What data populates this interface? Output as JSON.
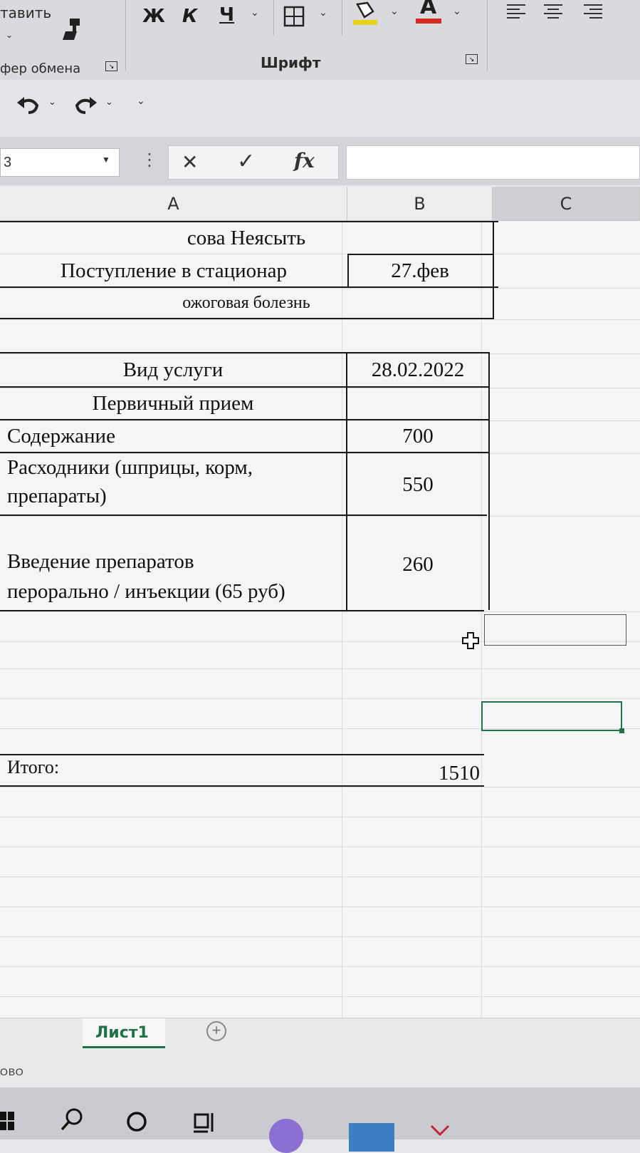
{
  "ribbon": {
    "paste_label": "тавить",
    "clipboard_group": "фер обмена",
    "font_group": "Шрифт",
    "bold": "Ж",
    "italic": "К",
    "underline": "Ч",
    "font_color_letter": "A",
    "icons": [
      "format-painter-icon",
      "borders-icon",
      "fill-color-icon",
      "font-color-icon",
      "align-left-icon",
      "align-center-icon",
      "align-right-icon"
    ]
  },
  "qat": {
    "icons": [
      "undo-icon",
      "redo-icon",
      "customize-qat-icon"
    ]
  },
  "formula_bar": {
    "name_box": "3",
    "cancel_icon": "✕",
    "enter_icon": "✓",
    "fx": "fx",
    "formula_value": ""
  },
  "columns": [
    "A",
    "B",
    "C"
  ],
  "table": {
    "title": "сова Неясыть",
    "admission_label": "Поступление в стационар",
    "admission_date": "27.фев",
    "diagnosis": "ожоговая болезнь",
    "service_header": "Вид услуги",
    "service_date": "28.02.2022",
    "first_visit": "Первичный прием",
    "rows": [
      {
        "label": "Содержание",
        "value": "700"
      },
      {
        "label_line1": "Расходники (шприцы, корм,",
        "label_line2": "препараты)",
        "value": "550"
      },
      {
        "label_line1": "Введение препаратов",
        "label_line2": "перорально / инъекции (65 руб)",
        "value": "260"
      }
    ],
    "total_label": "Итого:",
    "total_value": "1510"
  },
  "sheet_tabs": {
    "active": "Лист1",
    "add_icon": "+"
  },
  "status": {
    "text": "ОВО"
  },
  "taskbar": {
    "icons": [
      "windows-icon",
      "search-icon",
      "cortana-icon",
      "task-view-icon",
      "app-icon",
      "mail-icon",
      "chevron-icon"
    ]
  },
  "colors": {
    "accent_green": "#217346",
    "fill_yellow": "#e8d21a",
    "font_red": "#d42a1f"
  }
}
